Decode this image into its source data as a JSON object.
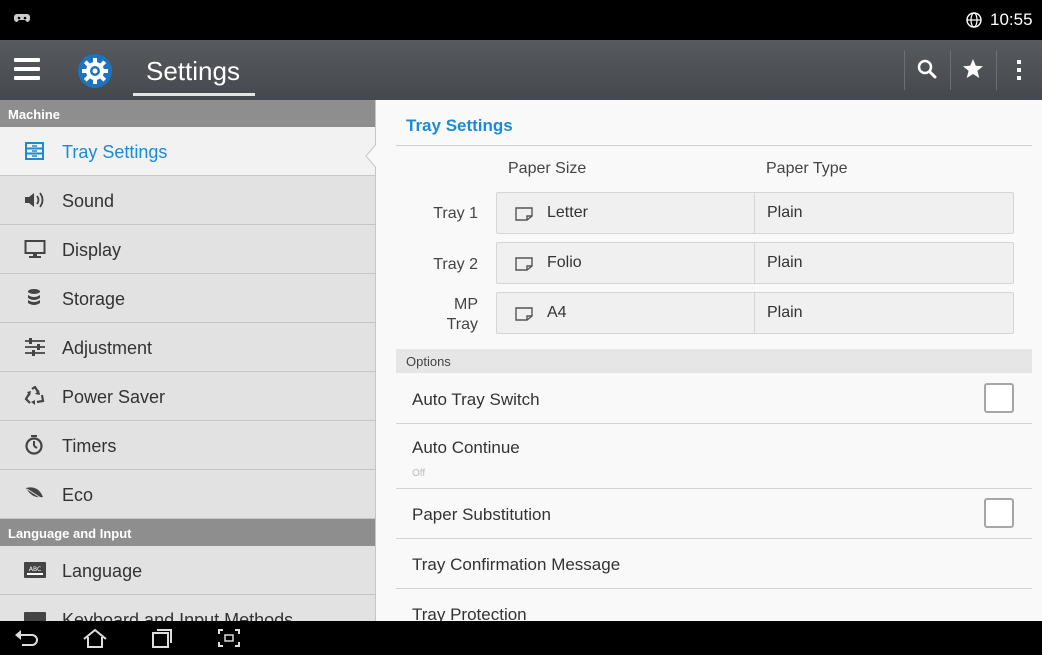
{
  "status_bar": {
    "time": "10:55",
    "notification_icon": "game-controller-icon",
    "network_icon": "globe-icon"
  },
  "action_bar": {
    "title": "Settings",
    "menu_icon": "hamburger-menu-icon",
    "app_icon": "settings-gear-icon",
    "actions": [
      "search-icon",
      "star-icon",
      "overflow-menu-icon"
    ]
  },
  "sidebar": {
    "sections": [
      {
        "header": "Machine",
        "items": [
          {
            "label": "Tray Settings",
            "icon": "tray-icon",
            "selected": true
          },
          {
            "label": "Sound",
            "icon": "speaker-icon"
          },
          {
            "label": "Display",
            "icon": "monitor-icon"
          },
          {
            "label": "Storage",
            "icon": "database-icon"
          },
          {
            "label": "Adjustment",
            "icon": "sliders-icon"
          },
          {
            "label": "Power Saver",
            "icon": "recycle-icon"
          },
          {
            "label": "Timers",
            "icon": "timer-icon"
          },
          {
            "label": "Eco",
            "icon": "leaf-icon"
          }
        ]
      },
      {
        "header": "Language and Input",
        "items": [
          {
            "label": "Language",
            "icon": "abc-keyboard-icon"
          },
          {
            "label": "Keyboard and Input Methods",
            "icon": "keyboard-icon"
          }
        ]
      }
    ]
  },
  "content": {
    "title": "Tray Settings",
    "columns": {
      "size": "Paper Size",
      "type": "Paper Type"
    },
    "trays": [
      {
        "label": "Tray 1",
        "size": "Letter",
        "type": "Plain"
      },
      {
        "label": "Tray 2",
        "size": "Folio",
        "type": "Plain"
      },
      {
        "label": "MP Tray",
        "label_line1": "MP",
        "label_line2": "Tray",
        "size": "A4",
        "type": "Plain"
      }
    ],
    "options_header": "Options",
    "options": {
      "auto_tray_switch": {
        "label": "Auto Tray Switch",
        "checked": false
      },
      "auto_continue": {
        "label": "Auto Continue",
        "value": "Off"
      },
      "paper_substitution": {
        "label": "Paper Substitution",
        "checked": false
      },
      "tray_confirmation": {
        "label": "Tray Confirmation Message"
      },
      "tray_protection": {
        "label": "Tray Protection"
      }
    }
  },
  "nav_bar": {
    "buttons": [
      "back-icon",
      "home-icon",
      "recent-apps-icon",
      "screenshot-icon"
    ]
  },
  "colors": {
    "accent": "#1a8bd6",
    "sidebar_bg": "#e2e2e2",
    "section_header_bg": "#8e8e8e",
    "action_bar_bg": "#4e5155"
  }
}
